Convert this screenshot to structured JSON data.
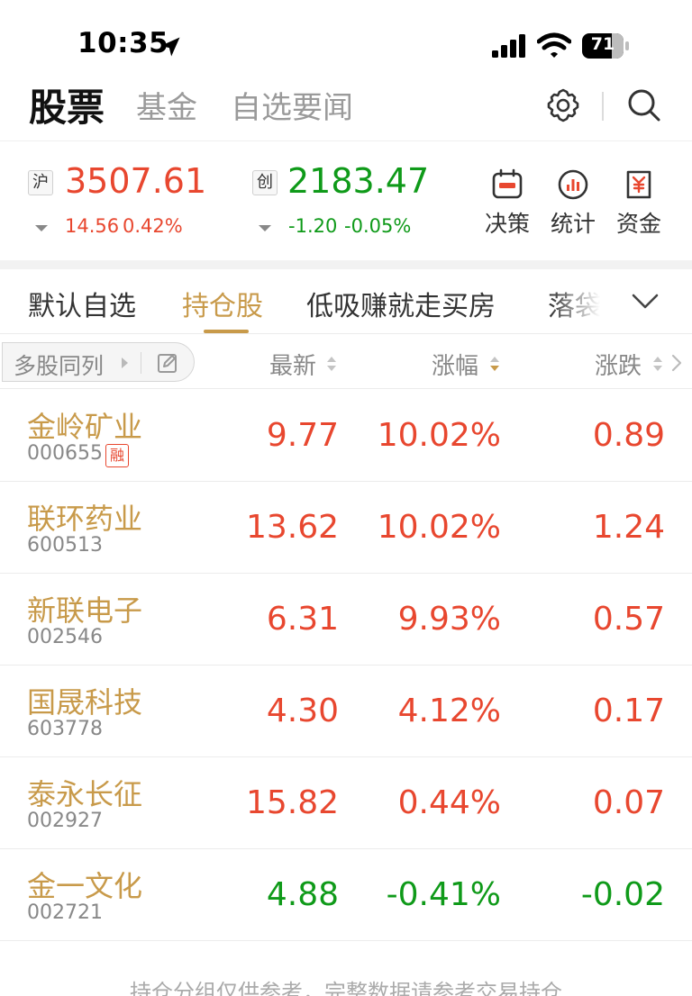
{
  "status_bar": {
    "time": "10:35",
    "battery": "71",
    "battery_level": 0.71
  },
  "top_nav": {
    "tabs": [
      "股票",
      "基金",
      "自选要闻"
    ],
    "active_tab": 0
  },
  "indices": [
    {
      "tag": "沪",
      "value": "3507.61",
      "change": "14.56",
      "pct": "0.42%",
      "trend": "up",
      "color": "#e8472f"
    },
    {
      "tag": "创",
      "value": "2183.47",
      "change": "-1.20",
      "pct": "-0.05%",
      "trend": "down",
      "color": "#0f9a19"
    }
  ],
  "tools": [
    {
      "label": "决策",
      "icon": "decision-icon"
    },
    {
      "label": "统计",
      "icon": "stats-icon"
    },
    {
      "label": "资金",
      "icon": "funds-icon"
    }
  ],
  "group_tabs": {
    "items": [
      "默认自选",
      "持仓股",
      "低吸赚就走买房",
      "落袋"
    ],
    "active": 1
  },
  "columns": {
    "multi_label": "多股同列",
    "latest": "最新",
    "pct": "涨幅",
    "change": "涨跌",
    "sorted_by": "涨幅"
  },
  "stocks": [
    {
      "name": "金岭矿业",
      "code": "000655",
      "badge": "融",
      "price": "9.77",
      "pct": "10.02%",
      "change": "0.89",
      "trend": "up"
    },
    {
      "name": "联环药业",
      "code": "600513",
      "badge": "",
      "price": "13.62",
      "pct": "10.02%",
      "change": "1.24",
      "trend": "up"
    },
    {
      "name": "新联电子",
      "code": "002546",
      "badge": "",
      "price": "6.31",
      "pct": "9.93%",
      "change": "0.57",
      "trend": "up"
    },
    {
      "name": "国晟科技",
      "code": "603778",
      "badge": "",
      "price": "4.30",
      "pct": "4.12%",
      "change": "0.17",
      "trend": "up"
    },
    {
      "name": "泰永长征",
      "code": "002927",
      "badge": "",
      "price": "15.82",
      "pct": "0.44%",
      "change": "0.07",
      "trend": "up"
    },
    {
      "name": "金一文化",
      "code": "002721",
      "badge": "",
      "price": "4.88",
      "pct": "-0.41%",
      "change": "-0.02",
      "trend": "down"
    }
  ],
  "footer_note": "持仓分组仅供参考，完整数据请参考交易持仓",
  "colors": {
    "up": "#e8472f",
    "down": "#0f9a19",
    "accent": "#c89a4a"
  }
}
